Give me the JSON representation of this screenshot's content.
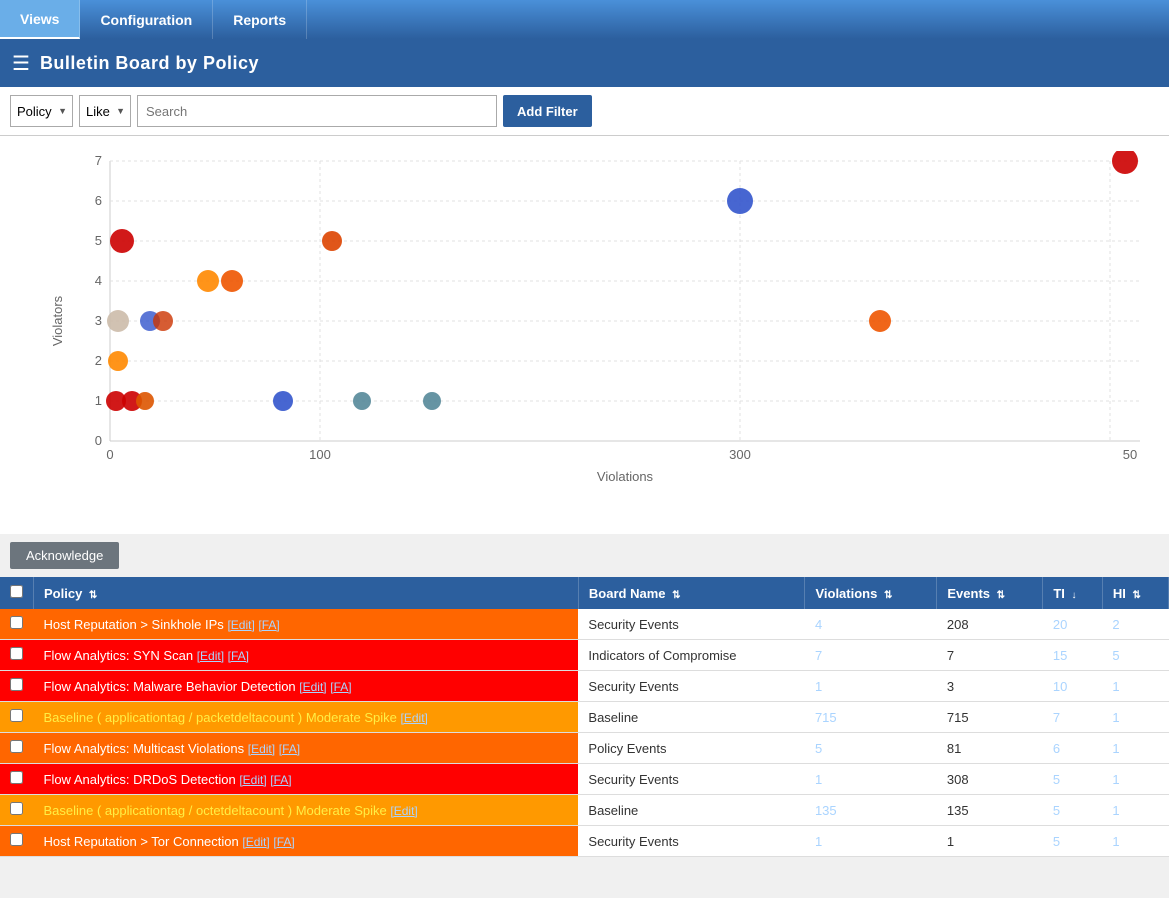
{
  "nav": {
    "items": [
      {
        "label": "Views",
        "active": true
      },
      {
        "label": "Configuration",
        "active": false
      },
      {
        "label": "Reports",
        "active": false
      }
    ]
  },
  "header": {
    "title": "Bulletin Board by Policy",
    "hamburger": "☰"
  },
  "filter": {
    "policy_label": "Policy",
    "like_label": "Like",
    "search_placeholder": "Search",
    "add_filter_label": "Add Filter"
  },
  "chart": {
    "y_axis_label": "Violators",
    "x_axis_label": "Violations",
    "y_ticks": [
      0,
      1,
      2,
      3,
      4,
      5,
      6,
      7
    ],
    "x_ticks": [
      0,
      100,
      300,
      "50"
    ]
  },
  "acknowledge_label": "Acknowledge",
  "table": {
    "columns": [
      {
        "label": "Policy",
        "sortable": true
      },
      {
        "label": "Board Name",
        "sortable": true
      },
      {
        "label": "Violations",
        "sortable": true
      },
      {
        "label": "Events",
        "sortable": true
      },
      {
        "label": "TI",
        "sortable": true,
        "active_sort": true
      },
      {
        "label": "HI",
        "sortable": true
      }
    ],
    "rows": [
      {
        "color_class": "row-orange-dark",
        "policy": "Host Reputation > Sinkhole IPs",
        "policy_edit": "[Edit]",
        "policy_fa": "[FA]",
        "board_name": "Security Events",
        "violations": "4",
        "events": "208",
        "ti": "20",
        "hi": "2"
      },
      {
        "color_class": "row-red",
        "policy": "Flow Analytics: SYN Scan",
        "policy_edit": "[Edit]",
        "policy_fa": "[FA]",
        "board_name": "Indicators of Compromise",
        "violations": "7",
        "events": "7",
        "ti": "15",
        "hi": "5"
      },
      {
        "color_class": "row-red",
        "policy": "Flow Analytics: Malware Behavior Detection",
        "policy_edit": "[Edit]",
        "policy_fa": "[FA]",
        "board_name": "Security Events",
        "violations": "1",
        "events": "3",
        "ti": "10",
        "hi": "1"
      },
      {
        "color_class": "row-orange-light",
        "policy": "Baseline ( applicationtag / packetdeltacount ) Moderate Spike",
        "policy_edit": "[Edit]",
        "policy_fa": "",
        "board_name": "Baseline",
        "violations": "715",
        "events": "715",
        "ti": "7",
        "hi": "1",
        "yellow_text": true
      },
      {
        "color_class": "row-orange-dark2",
        "policy": "Flow Analytics: Multicast Violations",
        "policy_edit": "[Edit]",
        "policy_fa": "[FA]",
        "board_name": "Policy Events",
        "violations": "5",
        "events": "81",
        "ti": "6",
        "hi": "1"
      },
      {
        "color_class": "row-red",
        "policy": "Flow Analytics: DRDoS Detection",
        "policy_edit": "[Edit]",
        "policy_fa": "[FA]",
        "board_name": "Security Events",
        "violations": "1",
        "events": "308",
        "ti": "5",
        "hi": "1"
      },
      {
        "color_class": "row-orange-light",
        "policy": "Baseline ( applicationtag / octetdeltacount ) Moderate Spike",
        "policy_edit": "[Edit]",
        "policy_fa": "",
        "board_name": "Baseline",
        "violations": "135",
        "events": "135",
        "ti": "5",
        "hi": "1",
        "yellow_text": true
      },
      {
        "color_class": "row-orange-dark",
        "policy": "Host Reputation > Tor Connection",
        "policy_edit": "[Edit]",
        "policy_fa": "[FA]",
        "board_name": "Security Events",
        "violations": "1",
        "events": "1",
        "ti": "5",
        "hi": "1"
      }
    ]
  }
}
